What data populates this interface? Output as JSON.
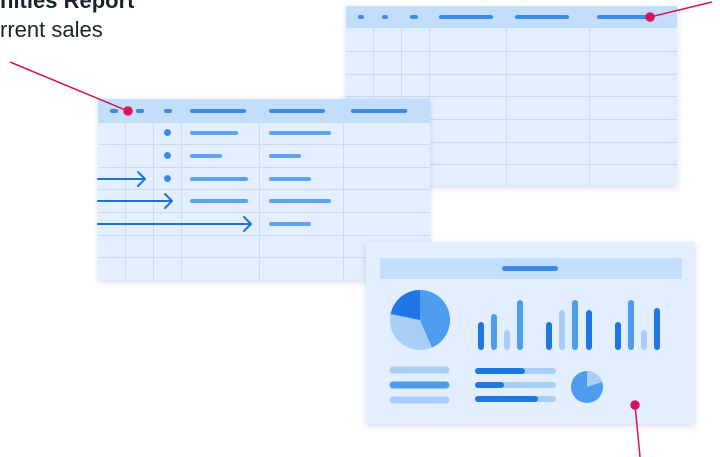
{
  "report": {
    "title": "nities Report",
    "subtitle": "rrent sales"
  },
  "colors": {
    "accent": "#3c8ae6",
    "sheet_background": "#e3efff",
    "sheet_header": "#c3defb",
    "grid_line": "#c6ddf6",
    "callout": "#d6145f",
    "arrow": "#1d72d8",
    "bar_dark": "#1f77e5",
    "bar_mid": "#4d9cee",
    "bar_light": "#a9cff7"
  },
  "elements": {
    "back_sheet": "spreadsheet-back",
    "front_sheet": "spreadsheet-front",
    "dashboard": "dashboard-card",
    "callouts": 3,
    "arrows": 3
  }
}
